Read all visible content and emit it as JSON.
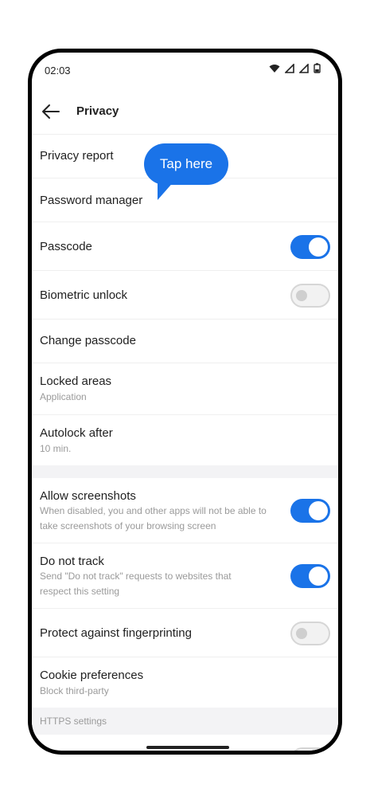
{
  "status_bar": {
    "time": "02:03"
  },
  "header": {
    "title": "Privacy"
  },
  "tooltip": {
    "text": "Tap here"
  },
  "rows": {
    "privacy_report": {
      "label": "Privacy report"
    },
    "password_manager": {
      "label": "Password manager"
    },
    "passcode": {
      "label": "Passcode",
      "toggle": true
    },
    "biometric_unlock": {
      "label": "Biometric unlock",
      "toggle": false
    },
    "change_passcode": {
      "label": "Change passcode"
    },
    "locked_areas": {
      "label": "Locked areas",
      "sub": "Application"
    },
    "autolock_after": {
      "label": "Autolock after",
      "sub": "10 min."
    },
    "allow_screenshots": {
      "label": "Allow screenshots",
      "sub": "When disabled, you and other apps will not be able to take screenshots of your browsing screen",
      "toggle": true
    },
    "do_not_track": {
      "label": "Do not track",
      "sub": "Send \"Do not track\" requests to websites that respect this setting",
      "toggle": true
    },
    "protect_fingerprinting": {
      "label": "Protect against fingerprinting",
      "toggle": false
    },
    "cookie_preferences": {
      "label": "Cookie preferences",
      "sub": "Block third-party"
    }
  },
  "section": {
    "https_settings": "HTTPS settings"
  },
  "colors": {
    "accent": "#1a73e8",
    "toggle_off": "#f2f2f2",
    "divider": "#efefef"
  }
}
